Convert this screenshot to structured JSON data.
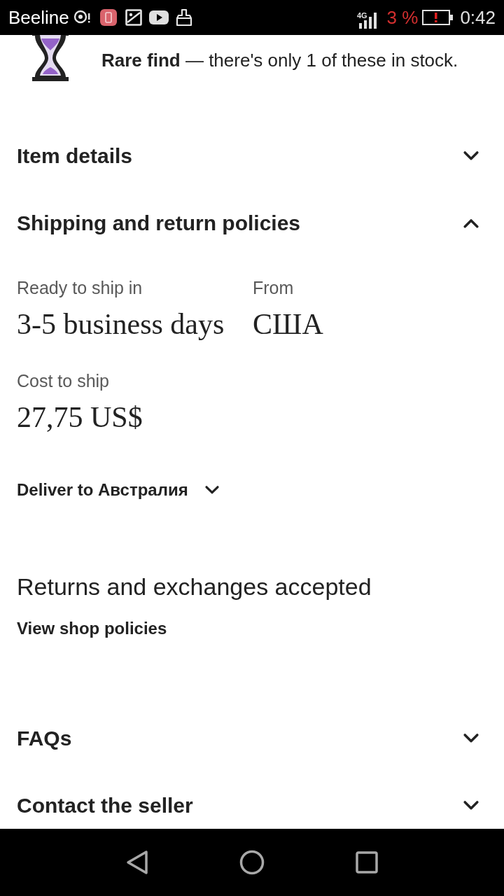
{
  "status_bar": {
    "carrier": "Beeline",
    "network": "4G",
    "battery": "3 %",
    "time": "0:42"
  },
  "stock_notice": {
    "text": "**Rare find** — there's only 1 of these in stock."
  },
  "sections": [
    {
      "title": "Item details",
      "expanded": false
    },
    {
      "title": "Shipping and return policies",
      "expanded": true,
      "details": {
        "fields": [
          {
            "label": "Ready to ship in",
            "value": "3-5 business days"
          },
          {
            "label": "From",
            "value": "США"
          },
          {
            "label": "Cost to ship",
            "value": "27,75 US$"
          }
        ],
        "deliver_to": {
          "label": "Deliver to Австралия",
          "expanded": false
        },
        "returns": "Returns and exchanges accepted",
        "link": "View shop policies"
      }
    },
    {
      "title": "FAQs",
      "expanded": false
    },
    {
      "title": "Contact the seller",
      "expanded": false
    }
  ]
}
